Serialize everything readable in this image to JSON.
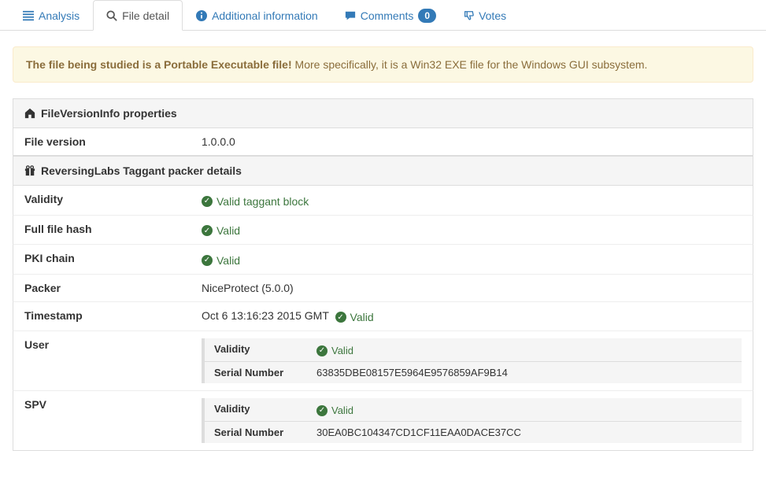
{
  "tabs": {
    "analysis": "Analysis",
    "file_detail": "File detail",
    "additional_info": "Additional information",
    "comments": "Comments",
    "comments_count": "0",
    "votes": "Votes"
  },
  "alert": {
    "strong": "The file being studied is a Portable Executable file!",
    "rest": " More specifically, it is a Win32 EXE file for the Windows GUI subsystem."
  },
  "fvi": {
    "header": "FileVersionInfo properties",
    "file_version_label": "File version",
    "file_version_value": "1.0.0.0"
  },
  "rl": {
    "header": "ReversingLabs Taggant packer details",
    "validity_label": "Validity",
    "validity_value": "Valid taggant block",
    "full_hash_label": "Full file hash",
    "full_hash_value": "Valid",
    "pki_label": "PKI chain",
    "pki_value": "Valid",
    "packer_label": "Packer",
    "packer_value": "NiceProtect (5.0.0)",
    "timestamp_label": "Timestamp",
    "timestamp_value": "Oct 6 13:16:23 2015 GMT",
    "timestamp_valid": "Valid",
    "user_label": "User",
    "user_validity_label": "Validity",
    "user_validity_value": "Valid",
    "user_serial_label": "Serial Number",
    "user_serial_value": "63835DBE08157E5964E9576859AF9B14",
    "spv_label": "SPV",
    "spv_validity_label": "Validity",
    "spv_validity_value": "Valid",
    "spv_serial_label": "Serial Number",
    "spv_serial_value": "30EA0BC104347CD1CF11EAA0DACE37CC"
  }
}
